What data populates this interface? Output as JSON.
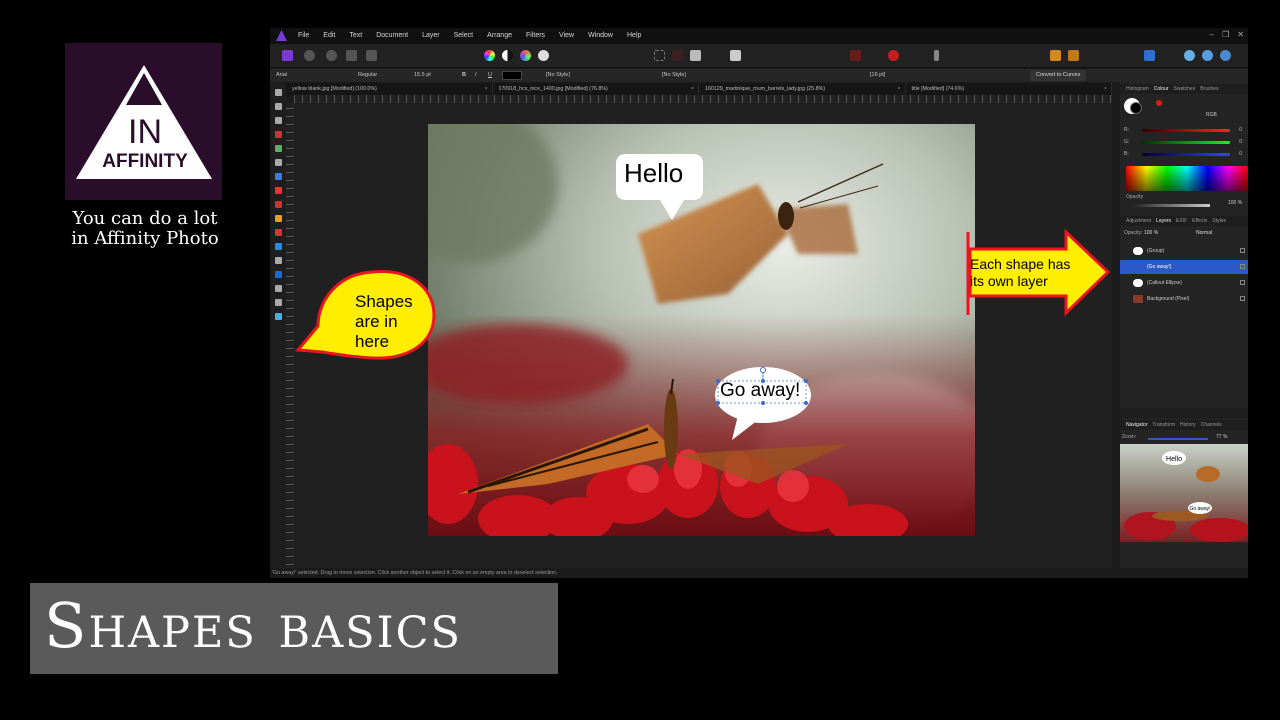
{
  "branding": {
    "logo_line1": "IN",
    "logo_line2": "AFFINITY",
    "caption_line1": "You can do a lot",
    "caption_line2": "in Affinity Photo",
    "title": "Shapes basics"
  },
  "menu": [
    "File",
    "Edit",
    "Text",
    "Document",
    "Layer",
    "Select",
    "Arrange",
    "Filters",
    "View",
    "Window",
    "Help"
  ],
  "context": {
    "font": "Arial",
    "weight": "Regular",
    "size": "15.5 pt",
    "char_style": "[No Style]",
    "para_style": "[No Style]",
    "leading": "[16 pt]",
    "curves_button": "Convert to Curves"
  },
  "tabs": [
    "yellow blank.jpg [Modified] (100.0%)",
    "170918_hcs_nice_1400.jpg [Modified] (76.8%)",
    "160129_martinique_mum_barrels_lady.jpg (25.8%)",
    "title [Modified] (74.6%)"
  ],
  "status_text": "'Go away!' selected. Drag to move selection. Click another object to select it. Click on an empty area to deselect selection.",
  "panel_tabs_top": [
    "Histogram",
    "Colour",
    "Swatches",
    "Brushes"
  ],
  "colour_panel": {
    "mode": "RGB",
    "r_label": "R:",
    "g_label": "G:",
    "b_label": "B:",
    "r_value": "0",
    "g_value": "0",
    "b_value": "0",
    "opacity_label": "Opacity",
    "opacity_value": "100 %"
  },
  "panel_tabs_mid": [
    "Adjustment",
    "Layers",
    "EXIF",
    "Effects",
    "Styles"
  ],
  "layers_panel": {
    "opacity_label": "Opacity:",
    "opacity_value": "100 %",
    "blend_mode": "Normal",
    "layers": [
      {
        "name": "(Group)",
        "selected": false
      },
      {
        "name": "(Go away!)",
        "selected": true
      },
      {
        "name": "(Callout Ellipse)",
        "selected": false
      },
      {
        "name": "Background (Pixel)",
        "selected": false
      }
    ]
  },
  "panel_tabs_bottom": [
    "Navigator",
    "Transform",
    "History",
    "Channels"
  ],
  "navigator": {
    "zoom_label": "Zoom:",
    "zoom_value": "77 %",
    "thumb_hello": "Hello",
    "thumb_goaway": "Go away!"
  },
  "canvas": {
    "hello": "Hello",
    "go_away": "Go away!"
  },
  "annotations": {
    "shapes_line1": "Shapes",
    "shapes_line2": "are in",
    "shapes_line3": "here",
    "layer_line1": "Each shape has",
    "layer_line2": "its own layer"
  },
  "colors": {
    "accent_purple": "#7a3ad6",
    "selection_blue": "#2d58c7",
    "callout_yellow": "#ffee00",
    "callout_red": "#e8141e"
  }
}
